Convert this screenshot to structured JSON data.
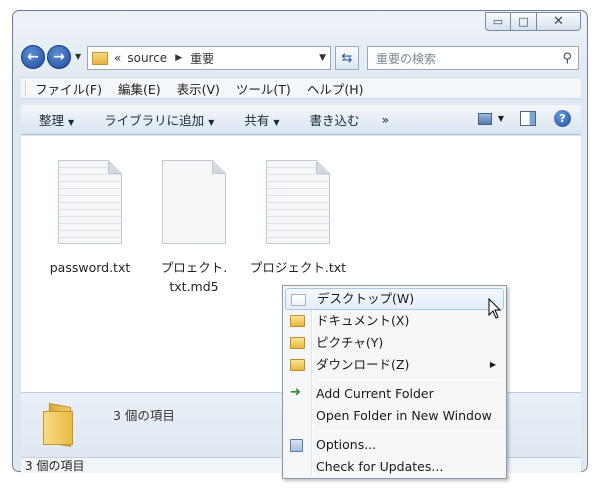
{
  "window": {
    "caption_buttons": {
      "minimize": "▭",
      "maximize": "□",
      "close": "✕"
    }
  },
  "address": {
    "chevron": "«",
    "path": [
      "source",
      "重要"
    ],
    "search_placeholder": "重要の検索"
  },
  "menu": [
    "ファイル(F)",
    "編集(E)",
    "表示(V)",
    "ツール(T)",
    "ヘルプ(H)"
  ],
  "commands": [
    "整理",
    "ライブラリに追加",
    "共有",
    "書き込む",
    "»"
  ],
  "files": [
    {
      "name": "password.txt",
      "icon": "text-file-icon"
    },
    {
      "name": "プロェクト.",
      "name2": "txt.md5",
      "icon": "blank-file-icon"
    },
    {
      "name": "プロジェクト.txt",
      "icon": "text-file-icon"
    }
  ],
  "details": {
    "count_text": "3 個の項目"
  },
  "status": {
    "text": "3 個の項目"
  },
  "context_menu": {
    "items": [
      {
        "label": "デスクトップ(W)",
        "icon": "folder-icon",
        "highlighted": true
      },
      {
        "label": "ドキュメント(X)",
        "icon": "folder-icon"
      },
      {
        "label": "ピクチャ(Y)",
        "icon": "folder-icon"
      },
      {
        "label": "ダウンロード(Z)",
        "icon": "folder-icon",
        "submenu": true
      },
      {
        "label": "Add Current Folder",
        "icon": "add-folder-icon"
      },
      {
        "label": "Open Folder in New Window"
      },
      {
        "label": "Options...",
        "icon": "options-icon"
      },
      {
        "label": "Check for Updates..."
      }
    ]
  },
  "colors": {
    "accent": "#1f4a9c",
    "highlight": "#e3eefa",
    "folder": "#e6b83e"
  }
}
